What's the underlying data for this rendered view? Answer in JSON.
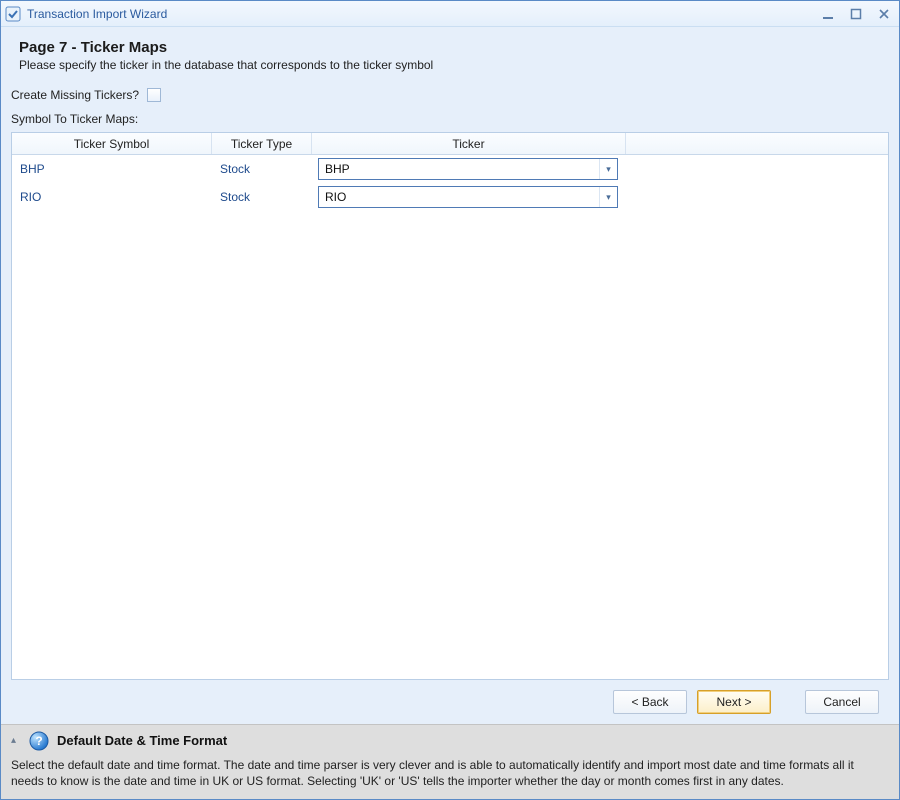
{
  "window": {
    "title": "Transaction Import Wizard"
  },
  "header": {
    "title": "Page 7 - Ticker Maps",
    "subtitle": "Please specify the ticker in the database that corresponds to the ticker symbol"
  },
  "create_missing": {
    "label": "Create Missing Tickers?",
    "checked": false
  },
  "maps_label": "Symbol To Ticker Maps:",
  "grid": {
    "columns": {
      "symbol": "Ticker Symbol",
      "type": "Ticker Type",
      "ticker": "Ticker"
    },
    "rows": [
      {
        "symbol": "BHP",
        "type": "Stock",
        "ticker": "BHP"
      },
      {
        "symbol": "RIO",
        "type": "Stock",
        "ticker": "RIO"
      }
    ]
  },
  "buttons": {
    "back": "< Back",
    "next": "Next >",
    "cancel": "Cancel"
  },
  "help": {
    "title": "Default Date & Time Format",
    "body": "Select the default date and time format. The date and time parser is very clever and is able to automatically identify and import most date and time formats all it needs to know is the date and time in UK or US format. Selecting 'UK' or 'US' tells the importer whether the day or month comes first in any dates."
  }
}
